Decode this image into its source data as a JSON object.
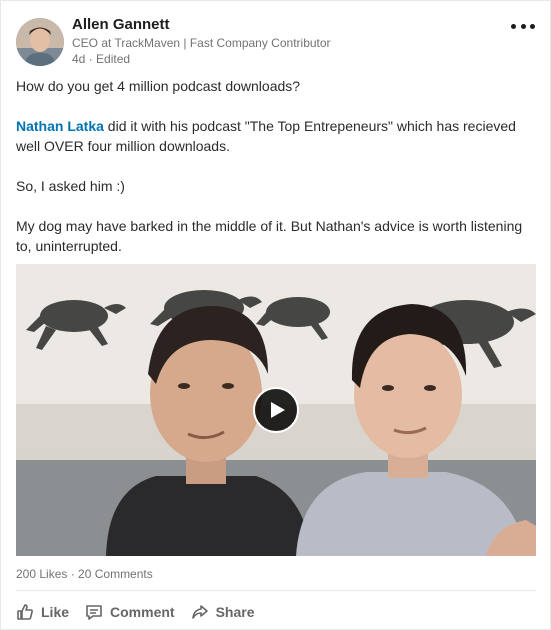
{
  "post": {
    "author": {
      "name": "Allen Gannett",
      "headline": "CEO at TrackMaven | Fast Company Contributor",
      "meta": "4d · Edited"
    },
    "menu_icon": "more-horizontal-icon",
    "text": {
      "line1": "How do you get 4 million podcast downloads?",
      "mention": "Nathan Latka",
      "line2_rest": " did it with his podcast \"The Top Entrepeneurs\" which has recieved well OVER four million downloads.",
      "line3": "So, I asked him :)",
      "line4": "My dog may have barked in the middle of it. But Nathan's advice is worth listening to, uninterrupted."
    },
    "video": {
      "play_icon": "play-icon"
    }
  },
  "social": {
    "likes": "200 Likes",
    "separator": " · ",
    "comments": "20 Comments"
  },
  "actions": [
    {
      "label": "Like",
      "icon": "thumbs-up-icon"
    },
    {
      "label": "Comment",
      "icon": "comment-icon"
    },
    {
      "label": "Share",
      "icon": "share-icon"
    }
  ],
  "colors": {
    "link": "#0073b1",
    "muted": "#737373",
    "action": "#666666"
  }
}
